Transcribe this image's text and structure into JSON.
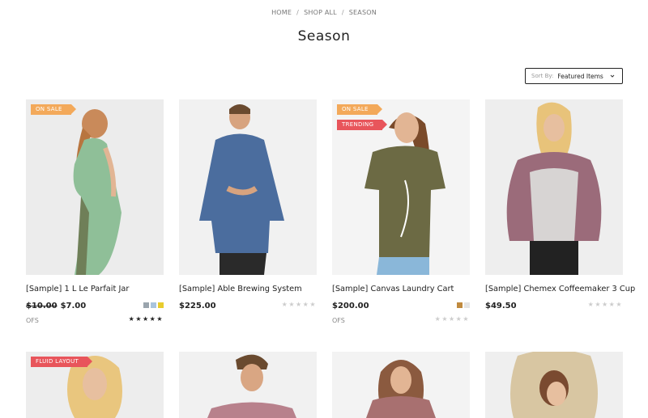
{
  "breadcrumb": {
    "home": "HOME",
    "shop_all": "SHOP ALL",
    "current": "SEASON"
  },
  "page_title": "Season",
  "sort": {
    "label": "Sort By:",
    "value": "Featured Items"
  },
  "products": [
    {
      "title": "[Sample] 1 L Le Parfait Jar",
      "old_price": "$10.00",
      "price": "$7.00",
      "ofs": "OFS",
      "badges": [
        "ON SALE"
      ],
      "swatches": [
        "#9aa4ad",
        "#a9c4de",
        "#e8cc2e"
      ],
      "rating_filled": 5,
      "rating_dark": true
    },
    {
      "title": "[Sample] Able Brewing System",
      "price": "$225.00",
      "badges": [],
      "swatches": [],
      "rating_filled": 0
    },
    {
      "title": "[Sample] Canvas Laundry Cart",
      "price": "$200.00",
      "ofs": "OFS",
      "badges": [
        "ON SALE",
        "TRENDING"
      ],
      "swatches": [
        "#c08a3e",
        "#e4e4e4"
      ],
      "rating_filled": 0
    },
    {
      "title": "[Sample] Chemex Coffeemaker 3 Cup",
      "price": "$49.50",
      "badges": [],
      "swatches": [],
      "rating_filled": 0
    }
  ],
  "row2_badges": [
    "FLUID LAYOUT"
  ],
  "stars_glyph": "★★★★★",
  "colors": {
    "sale": "#f3a95a",
    "trending": "#e8555b"
  }
}
